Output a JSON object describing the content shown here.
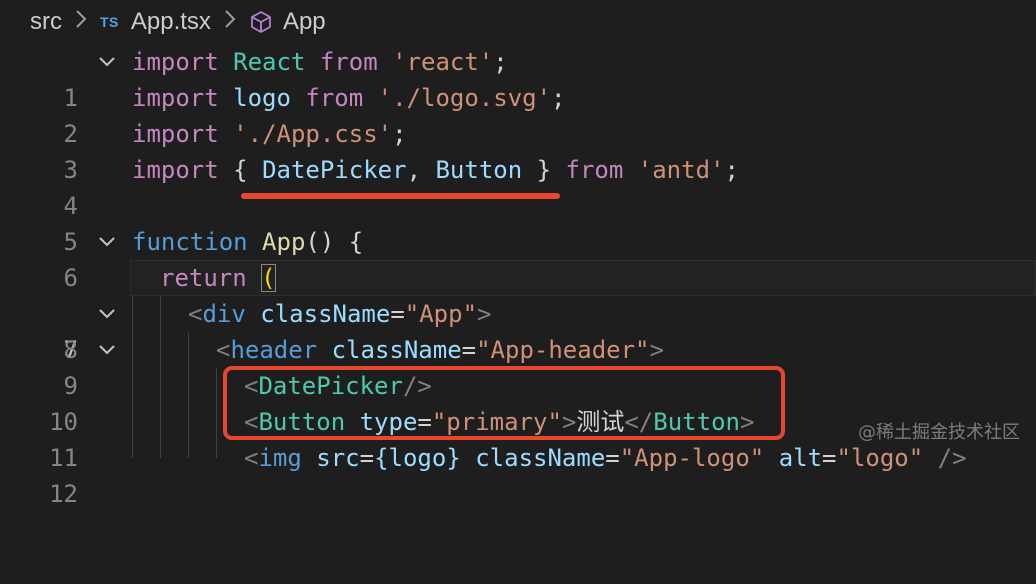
{
  "breadcrumb": {
    "folder": "src",
    "file_badge": "TS",
    "file": "App.tsx",
    "symbol": "App",
    "separator": ">"
  },
  "colors": {
    "background": "#1e1e1e",
    "annotation": "#e8472e",
    "keyword": "#c586c0",
    "string": "#ce9178",
    "type": "#4ec9b0",
    "variable": "#9cdcfe",
    "function": "#dcdcaa",
    "tag": "#569cd6"
  },
  "lines": [
    {
      "num": "1"
    },
    {
      "num": "2"
    },
    {
      "num": "3"
    },
    {
      "num": "4"
    },
    {
      "num": "5"
    },
    {
      "num": "6"
    },
    {
      "num": "7"
    },
    {
      "num": "8"
    },
    {
      "num": "9"
    },
    {
      "num": "10"
    },
    {
      "num": "11"
    },
    {
      "num": "12"
    }
  ],
  "code": {
    "l1": {
      "import": "import",
      "react": "React",
      "from": "from",
      "src": "'react'",
      "semi": ";"
    },
    "l2": {
      "import": "import",
      "logo": "logo",
      "from": "from",
      "src": "'./logo.svg'",
      "semi": ";"
    },
    "l3": {
      "import": "import",
      "src": "'./App.css'",
      "semi": ";"
    },
    "l4": {
      "import": "import",
      "open": "{",
      "datepicker": "DatePicker",
      "comma": ",",
      "button": "Button",
      "close": "}",
      "from": "from",
      "src": "'antd'",
      "semi": ";"
    },
    "l6": {
      "function": "function",
      "name": "App",
      "parens": "()",
      "brace": "{"
    },
    "l7": {
      "return": "return",
      "paren": "("
    },
    "l8": {
      "lt": "<",
      "tag": "div",
      "attr": "className",
      "eq": "=",
      "val": "\"App\"",
      "gt": ">"
    },
    "l9": {
      "lt": "<",
      "tag": "header",
      "attr": "className",
      "eq": "=",
      "val": "\"App-header\"",
      "gt": ">"
    },
    "l10": {
      "lt": "<",
      "tag": "DatePicker",
      "close": "/>"
    },
    "l11": {
      "lt": "<",
      "tag": "Button",
      "attr": "type",
      "eq": "=",
      "val": "\"primary\"",
      "gt": ">",
      "text": "测试",
      "endlt": "</",
      "endtag": "Button",
      "endgt": ">"
    },
    "l12": {
      "lt": "<",
      "tag": "img",
      "attr1": "src",
      "eq1": "=",
      "val1": "{logo}",
      "attr2": "className",
      "eq2": "=",
      "val2": "\"App-logo\"",
      "attr3": "alt",
      "eq3": "=",
      "val3": "\"logo\"",
      "close": "/>"
    }
  },
  "watermark": "@稀土掘金技术社区"
}
